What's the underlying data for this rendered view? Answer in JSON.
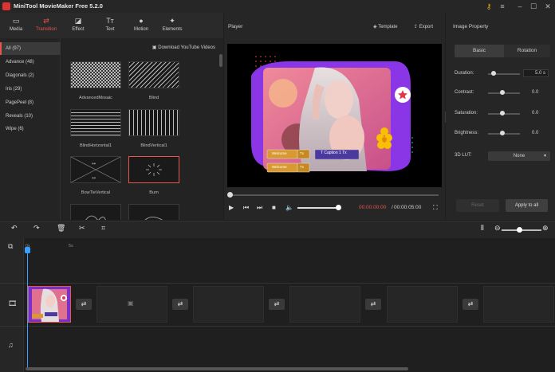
{
  "app": {
    "title": "MiniTool MovieMaker Free 5.2.0"
  },
  "toolbar": [
    {
      "label": "Media",
      "icon": "folder-icon"
    },
    {
      "label": "Transition",
      "icon": "transition-icon"
    },
    {
      "label": "Effect",
      "icon": "effect-icon"
    },
    {
      "label": "Text",
      "icon": "text-icon"
    },
    {
      "label": "Motion",
      "icon": "motion-icon"
    },
    {
      "label": "Elements",
      "icon": "elements-icon"
    }
  ],
  "categories": [
    {
      "label": "All (97)"
    },
    {
      "label": "Advance (48)"
    },
    {
      "label": "Diagonals (2)"
    },
    {
      "label": "Iris (29)"
    },
    {
      "label": "PagePeel (8)"
    },
    {
      "label": "Reveals (10)"
    },
    {
      "label": "Wipe (6)"
    }
  ],
  "grid": {
    "download_link": "Download YouTube Videos",
    "items": [
      {
        "label": "AdvancedMosaic"
      },
      {
        "label": "Blind"
      },
      {
        "label": "BlindHorizontal1"
      },
      {
        "label": "BlindVertical1"
      },
      {
        "label": "BowTieVertical"
      },
      {
        "label": "Burn"
      }
    ]
  },
  "player": {
    "title": "Player",
    "template_label": "Template",
    "export_label": "Export",
    "time_current": "00:00:00:00",
    "time_separator": "/",
    "time_total": "00:00:05:00",
    "volume": 0.9,
    "caption_1": "Caption 1",
    "caption_chips": [
      "Welcome",
      "Welcome"
    ],
    "chip_badge": "Tx"
  },
  "properties": {
    "title": "Image Property",
    "tab_basic": "Basic",
    "tab_rotation": "Rotation",
    "duration_label": "Duration:",
    "duration_value": "5.0 s",
    "contrast_label": "Contrast:",
    "contrast_value": "0.0",
    "saturation_label": "Saturation:",
    "saturation_value": "0.0",
    "brightness_label": "Brightness:",
    "brightness_value": "0.0",
    "lut_label": "3D LUT:",
    "lut_value": "None",
    "reset_label": "Reset",
    "apply_label": "Apply to all"
  },
  "timeline": {
    "ruler_start": "0s",
    "ruler_mark": "5s"
  },
  "colors": {
    "accent": "#e8554e",
    "playhead": "#3aa0ff"
  }
}
